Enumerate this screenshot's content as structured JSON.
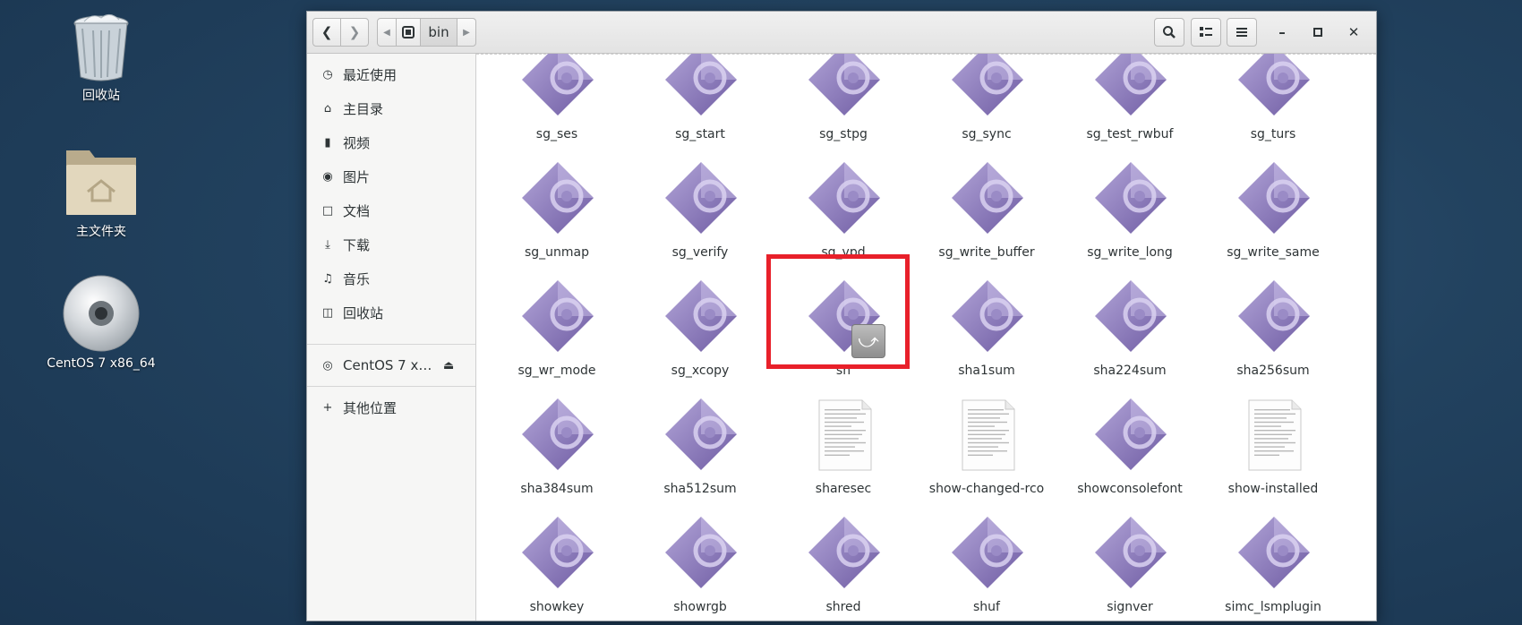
{
  "desktop": {
    "icons": [
      {
        "label": "回收站"
      },
      {
        "label": "主文件夹"
      },
      {
        "label": "CentOS 7 x86_64"
      }
    ]
  },
  "window": {
    "path_label": "bin",
    "sidebar": {
      "places": [
        {
          "label": "最近使用",
          "icon": "clock-icon"
        },
        {
          "label": "主目录",
          "icon": "home-icon"
        },
        {
          "label": "视频",
          "icon": "video-icon"
        },
        {
          "label": "图片",
          "icon": "camera-icon"
        },
        {
          "label": "文档",
          "icon": "document-icon"
        },
        {
          "label": "下载",
          "icon": "download-icon"
        },
        {
          "label": "音乐",
          "icon": "music-icon"
        },
        {
          "label": "回收站",
          "icon": "trash-icon"
        }
      ],
      "device": {
        "label": "CentOS 7 x…",
        "icon": "disc-icon"
      },
      "other": {
        "label": "其他位置",
        "icon": "plus-icon"
      }
    },
    "files": [
      {
        "name": "sg_ses",
        "type": "exec"
      },
      {
        "name": "sg_start",
        "type": "exec"
      },
      {
        "name": "sg_stpg",
        "type": "exec"
      },
      {
        "name": "sg_sync",
        "type": "exec"
      },
      {
        "name": "sg_test_rwbuf",
        "type": "exec"
      },
      {
        "name": "sg_turs",
        "type": "exec"
      },
      {
        "name": "sg_unmap",
        "type": "exec"
      },
      {
        "name": "sg_verify",
        "type": "exec"
      },
      {
        "name": "sg_vpd",
        "type": "exec"
      },
      {
        "name": "sg_write_buffer",
        "type": "exec"
      },
      {
        "name": "sg_write_long",
        "type": "exec"
      },
      {
        "name": "sg_write_same",
        "type": "exec"
      },
      {
        "name": "sg_wr_mode",
        "type": "exec"
      },
      {
        "name": "sg_xcopy",
        "type": "exec"
      },
      {
        "name": "sh",
        "type": "link"
      },
      {
        "name": "sha1sum",
        "type": "exec"
      },
      {
        "name": "sha224sum",
        "type": "exec"
      },
      {
        "name": "sha256sum",
        "type": "exec"
      },
      {
        "name": "sha384sum",
        "type": "exec"
      },
      {
        "name": "sha512sum",
        "type": "exec"
      },
      {
        "name": "sharesec",
        "type": "text"
      },
      {
        "name": "show-changed-rco",
        "type": "text"
      },
      {
        "name": "showconsolefont",
        "type": "exec"
      },
      {
        "name": "show-installed",
        "type": "text"
      },
      {
        "name": "showkey",
        "type": "exec"
      },
      {
        "name": "showrgb",
        "type": "exec"
      },
      {
        "name": "shred",
        "type": "exec"
      },
      {
        "name": "shuf",
        "type": "exec"
      },
      {
        "name": "signver",
        "type": "exec"
      },
      {
        "name": "simc_lsmplugin",
        "type": "exec"
      }
    ],
    "highlighted_file": "sh",
    "colors": {
      "highlight": "#e8202a",
      "exec_icon": "#8b77b8"
    }
  }
}
